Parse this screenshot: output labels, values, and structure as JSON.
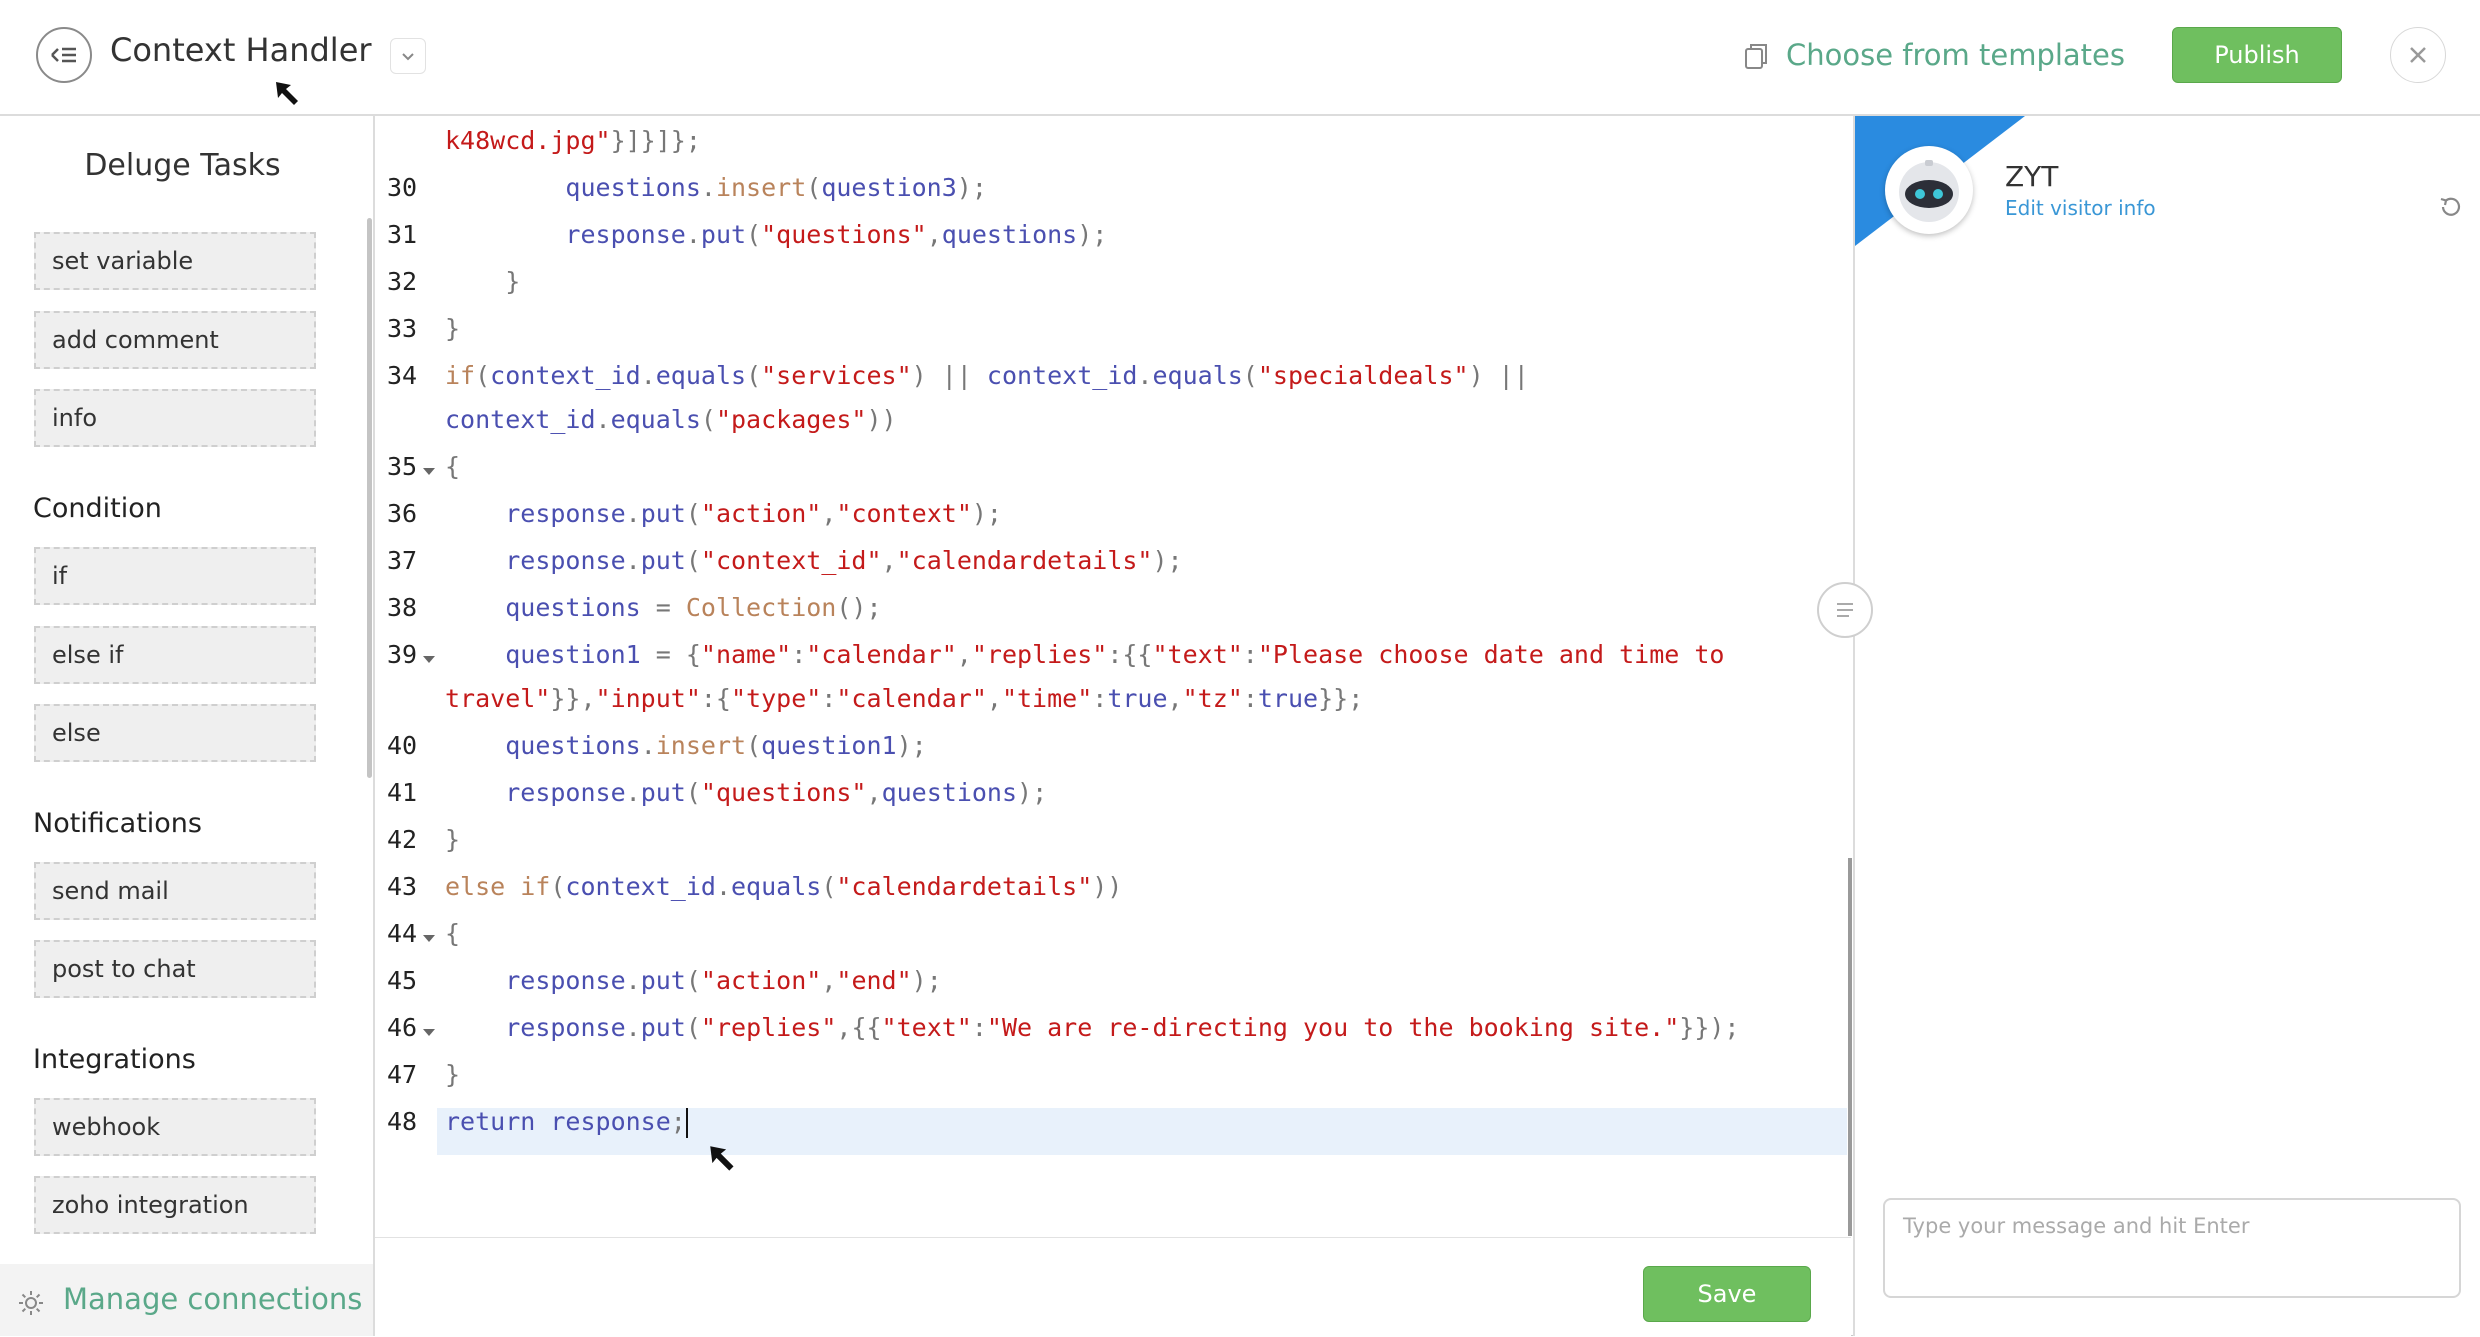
{
  "header": {
    "title": "Context Handler",
    "templates_link": "Choose from templates",
    "publish_label": "Publish"
  },
  "sidebar": {
    "heading": "Deluge Tasks",
    "general": [
      "set variable",
      "add comment",
      "info"
    ],
    "condition": {
      "label": "Condition",
      "items": [
        "if",
        "else if",
        "else"
      ]
    },
    "notifications": {
      "label": "Notifications",
      "items": [
        "send mail",
        "post to chat"
      ]
    },
    "integrations": {
      "label": "Integrations",
      "items": [
        "webhook",
        "zoho integration"
      ]
    },
    "manage_connections": "Manage connections"
  },
  "editor": {
    "line_numbers": [
      "",
      "30",
      "31",
      "32",
      "33",
      "34",
      "",
      "35",
      "36",
      "37",
      "38",
      "39",
      "",
      "40",
      "41",
      "42",
      "43",
      "44",
      "45",
      "46",
      "47",
      "48"
    ],
    "save_label": "Save"
  },
  "preview": {
    "bot_name": "ZYT",
    "edit_visitor": "Edit visitor info",
    "chat_placeholder": "Type your message and hit Enter"
  },
  "colors": {
    "accent_green": "#6fbf5f",
    "link_green": "#5aa889",
    "brand_blue": "#2a8be0",
    "keyword": "#b9835b",
    "identifier": "#4a4fb0",
    "string": "#c41a1a"
  }
}
